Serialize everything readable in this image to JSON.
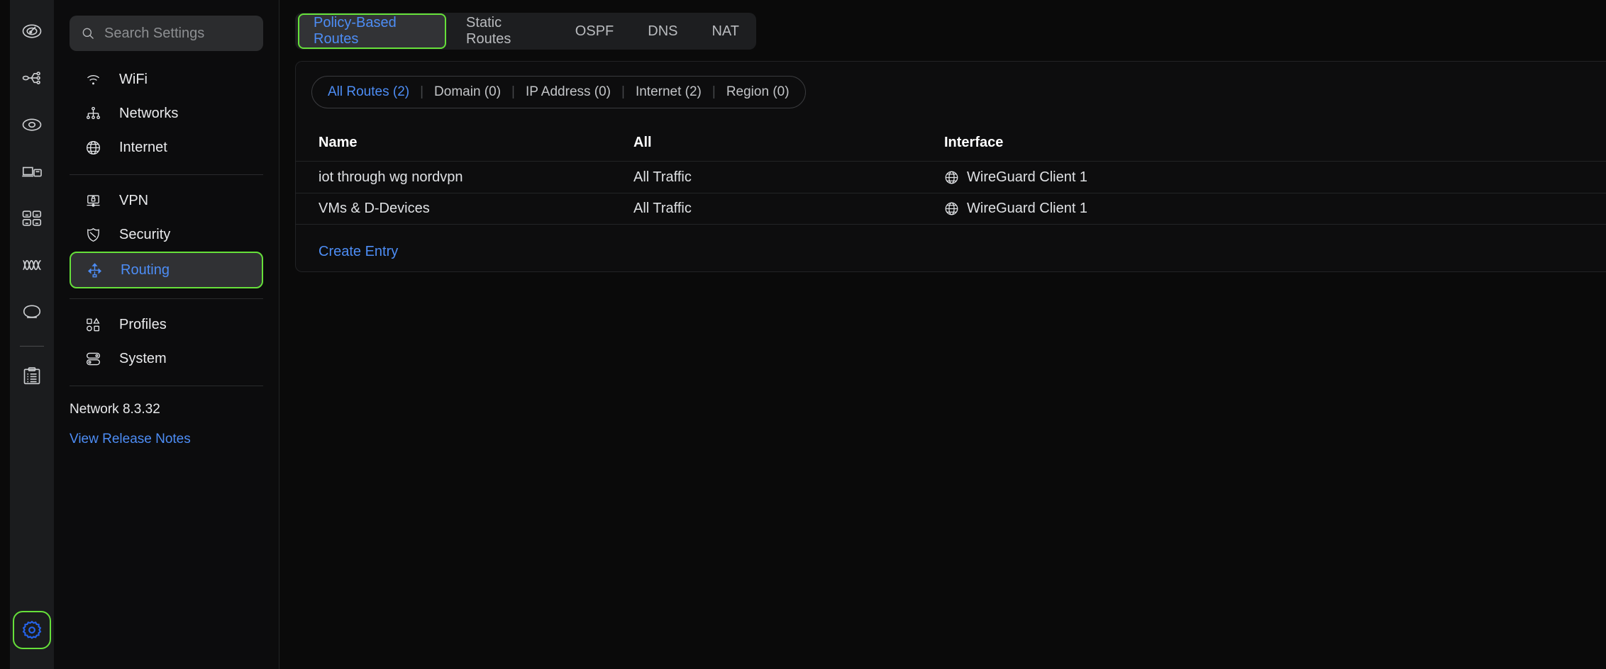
{
  "rail": {
    "items": [
      {
        "name": "dashboard-icon",
        "title": "Dashboard"
      },
      {
        "name": "topology-icon",
        "title": "Topology"
      },
      {
        "name": "devices-icon",
        "title": "Devices"
      },
      {
        "name": "client-devices-icon",
        "title": "Client Devices"
      },
      {
        "name": "users-icon",
        "title": "Users"
      },
      {
        "name": "insights-icon",
        "title": "Insights"
      },
      {
        "name": "hotspot-icon",
        "title": "Hotspot"
      }
    ],
    "lower_items": [
      {
        "name": "logs-icon",
        "title": "Logs"
      },
      {
        "name": "gear-icon",
        "title": "Settings",
        "active": true
      }
    ]
  },
  "sidebar": {
    "search": {
      "placeholder": "Search Settings",
      "value": "",
      "icon": "search-icon"
    },
    "groups": [
      {
        "items": [
          {
            "label": "WiFi",
            "icon": "wifi-icon",
            "selected": false
          },
          {
            "label": "Networks",
            "icon": "networks-icon",
            "selected": false
          },
          {
            "label": "Internet",
            "icon": "globe-icon",
            "selected": false
          }
        ]
      },
      {
        "items": [
          {
            "label": "VPN",
            "icon": "vpn-icon",
            "selected": false
          },
          {
            "label": "Security",
            "icon": "shield-icon",
            "selected": false
          },
          {
            "label": "Routing",
            "icon": "routing-icon",
            "selected": true
          }
        ]
      },
      {
        "items": [
          {
            "label": "Profiles",
            "icon": "profiles-icon",
            "selected": false
          },
          {
            "label": "System",
            "icon": "system-icon",
            "selected": false
          }
        ]
      }
    ],
    "version_text": "Network 8.3.32",
    "release_notes_label": "View Release Notes"
  },
  "main": {
    "tabs": [
      {
        "label": "Policy-Based Routes",
        "active": true
      },
      {
        "label": "Static Routes",
        "active": false
      },
      {
        "label": "OSPF",
        "active": false
      },
      {
        "label": "DNS",
        "active": false
      },
      {
        "label": "NAT",
        "active": false
      }
    ],
    "filters": [
      {
        "label": "All Routes (2)",
        "selected": true
      },
      {
        "label": "Domain (0)",
        "selected": false
      },
      {
        "label": "IP Address (0)",
        "selected": false
      },
      {
        "label": "Internet (2)",
        "selected": false
      },
      {
        "label": "Region (0)",
        "selected": false
      }
    ],
    "table": {
      "columns": [
        "Name",
        "All",
        "Interface"
      ],
      "rows": [
        {
          "name": "iot through wg nordvpn",
          "all": "All Traffic",
          "interface": "WireGuard Client 1",
          "interface_icon": "globe-icon"
        },
        {
          "name": "VMs & D-Devices",
          "all": "All Traffic",
          "interface": "WireGuard Client 1",
          "interface_icon": "globe-icon"
        }
      ]
    },
    "create_entry_label": "Create Entry"
  },
  "colors": {
    "accent_blue": "#4d8df5",
    "highlight_green": "#66e03a",
    "background": "#0a0a0a",
    "rail_background": "#1b1c1e",
    "card_background": "#0d0d0e"
  }
}
